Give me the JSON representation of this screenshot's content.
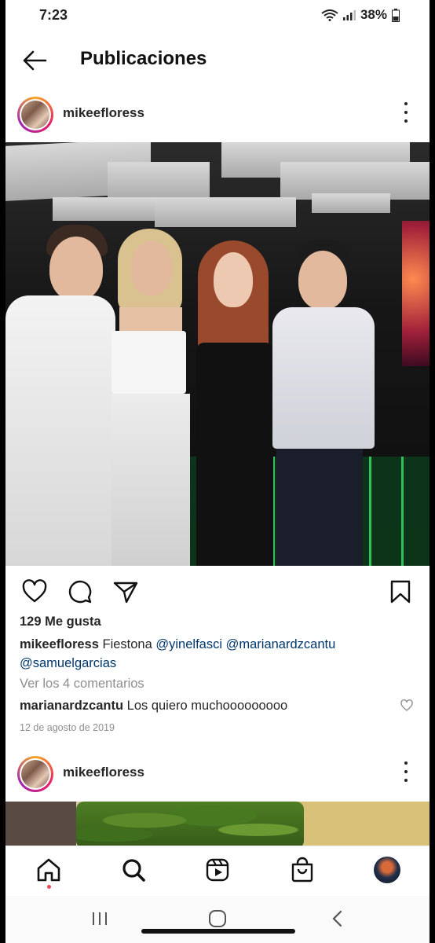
{
  "status_bar": {
    "time": "7:23",
    "battery": "38%"
  },
  "header": {
    "title": "Publicaciones"
  },
  "post": {
    "username": "mikeefloress",
    "likes": "129 Me gusta",
    "caption_user": "mikeefloress",
    "caption_text": "Fiestona",
    "mentions": [
      "@yinelfasci",
      "@marianardzcantu",
      "@samuelgarcias"
    ],
    "view_comments": "Ver los 4 comentarios",
    "comment_user": "marianardzcantu",
    "comment_text": "Los quiero muchooooooooo",
    "date": "12 de agosto de 2019"
  },
  "next_post": {
    "username": "mikeefloress"
  },
  "icons": {
    "back": "arrow-left-icon",
    "more": "more-vertical-icon",
    "like": "heart-icon",
    "comment": "comment-icon",
    "share": "send-icon",
    "save": "bookmark-icon",
    "home": "home-icon",
    "search": "search-icon",
    "reels": "reels-icon",
    "shop": "shopping-bag-icon"
  }
}
